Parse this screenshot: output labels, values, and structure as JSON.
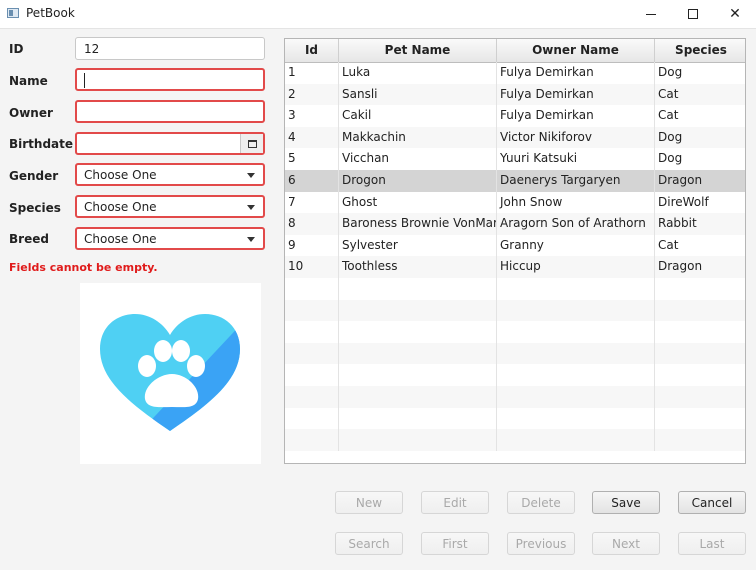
{
  "window": {
    "title": "PetBook"
  },
  "form": {
    "labels": {
      "id": "ID",
      "name": "Name",
      "owner": "Owner",
      "birthdate": "Birthdate",
      "gender": "Gender",
      "species": "Species",
      "breed": "Breed"
    },
    "values": {
      "id": "12",
      "name": "",
      "owner": "",
      "birthdate": ""
    },
    "selects": {
      "gender": "Choose One",
      "species": "Choose One",
      "breed": "Choose One"
    },
    "error_message": "Fields cannot be empty."
  },
  "table": {
    "columns": [
      "Id",
      "Pet Name",
      "Owner Name",
      "Species"
    ],
    "rows": [
      [
        "1",
        "Luka",
        "Fulya Demirkan",
        "Dog"
      ],
      [
        "2",
        "Sansli",
        "Fulya Demirkan",
        "Cat"
      ],
      [
        "3",
        "Cakil",
        "Fulya Demirkan",
        "Cat"
      ],
      [
        "4",
        "Makkachin",
        "Victor Nikiforov",
        "Dog"
      ],
      [
        "5",
        "Vicchan",
        "Yuuri Katsuki",
        "Dog"
      ],
      [
        "6",
        "Drogon",
        "Daenerys Targaryen",
        "Dragon"
      ],
      [
        "7",
        "Ghost",
        "John Snow",
        "DireWolf"
      ],
      [
        "8",
        "Baroness Brownie VonMarsh...",
        "Aragorn Son of Arathorn",
        "Rabbit"
      ],
      [
        "9",
        "Sylvester",
        "Granny",
        "Cat"
      ],
      [
        "10",
        "Toothless",
        "Hiccup",
        "Dragon"
      ]
    ],
    "selected_row": 6
  },
  "buttons": {
    "new": "New",
    "edit": "Edit",
    "delete": "Delete",
    "save": "Save",
    "cancel": "Cancel",
    "search": "Search",
    "first": "First",
    "previous": "Previous",
    "next": "Next",
    "last": "Last"
  },
  "colors": {
    "error": "#e01b1b",
    "selected_row": "#d4d4d4",
    "logo_light": "#4fd0f3",
    "logo_dark": "#3aa3f5"
  }
}
